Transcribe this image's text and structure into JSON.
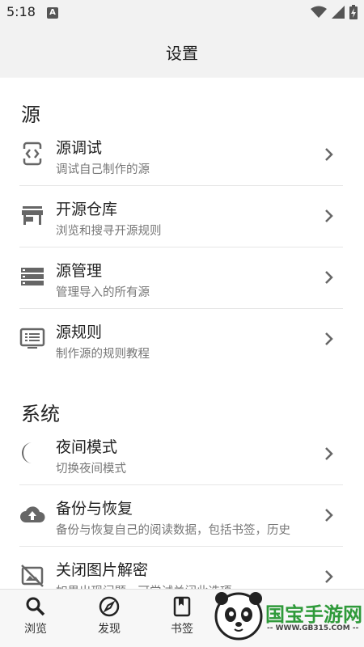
{
  "status_bar": {
    "time": "5:18",
    "notif_badge": "A"
  },
  "app_bar": {
    "title": "设置"
  },
  "sections": {
    "source": {
      "header": "源",
      "items": [
        {
          "title": "源调试",
          "subtitle": "调试自己制作的源",
          "icon": "code-brackets-icon"
        },
        {
          "title": "开源仓库",
          "subtitle": "浏览和搜寻开源规则",
          "icon": "store-icon"
        },
        {
          "title": "源管理",
          "subtitle": "管理导入的所有源",
          "icon": "list-storage-icon"
        },
        {
          "title": "源规则",
          "subtitle": "制作源的规则教程",
          "icon": "document-icon"
        }
      ]
    },
    "system": {
      "header": "系统",
      "items": [
        {
          "title": "夜间模式",
          "subtitle": "切换夜间模式",
          "icon": "moon-icon"
        },
        {
          "title": "备份与恢复",
          "subtitle": "备份与恢复自己的阅读数据，包括书签，历史",
          "icon": "cloud-upload-icon"
        },
        {
          "title": "关闭图片解密",
          "subtitle": "如果出现问题，可尝试关闭此选项",
          "icon": "image-off-icon"
        }
      ]
    }
  },
  "bottom_nav": [
    {
      "label": "浏览",
      "icon": "search-icon"
    },
    {
      "label": "发现",
      "icon": "compass-icon"
    },
    {
      "label": "书签",
      "icon": "bookmark-icon"
    }
  ],
  "watermark": {
    "text": "国宝手游网",
    "url": "-- WWW.GB315.COM --"
  },
  "colors": {
    "accent_green": "#2f9a3a",
    "icon_gray": "#666666",
    "divider": "#e6e6e6"
  }
}
